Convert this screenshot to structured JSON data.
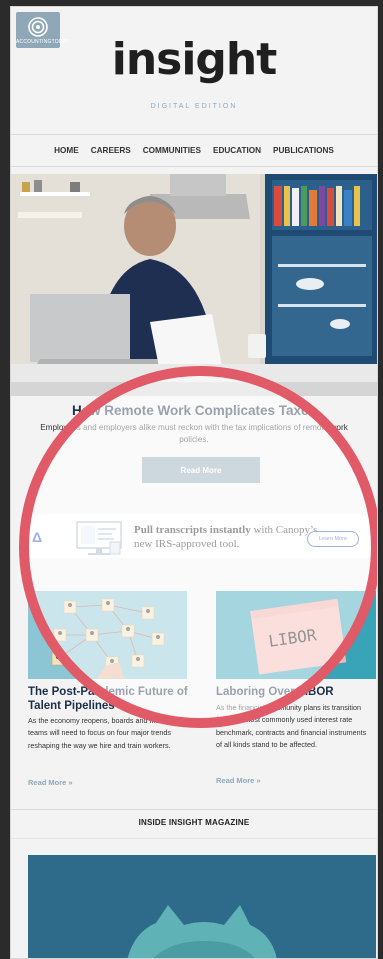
{
  "badge": {
    "text": "ACCOUNTINGTODAY"
  },
  "logo": {
    "title": "insight",
    "subtitle": "DIGITAL EDITION"
  },
  "nav": {
    "items": [
      "HOME",
      "CAREERS",
      "COMMUNITIES",
      "EDUCATION",
      "PUBLICATIONS"
    ]
  },
  "feature": {
    "title": "How Remote Work Complicates Taxes",
    "summary": "Employees and employers alike must reckon with the tax implications of remote work policies.",
    "button": "Read More"
  },
  "ad": {
    "logo": "Δ",
    "headline_bold": "Pull transcripts instantly",
    "headline_rest": " with Canopy’s new IRS-approved tool.",
    "button": "Learn More"
  },
  "cards": [
    {
      "title": "The Post-Pandemic Future of Talent Pipelines",
      "body": "As the economy reopens, boards and management teams will need to focus on four major trends reshaping the way we hire and train workers.",
      "link": "Read More »"
    },
    {
      "title": "Laboring Over LIBOR",
      "body": "As the financial community plans its transition from the most commonly used interest rate benchmark, contracts and financial instruments of all kinds stand to be affected.",
      "link": "Read More »",
      "image_text": "LIBOR"
    }
  ],
  "section": {
    "title": "INSIDE INSIGHT MAGAZINE"
  },
  "colors": {
    "accent": "#8fa8b7",
    "headline": "#1c2f4a",
    "circle": "#e15a67",
    "ad_blue": "#2453c9"
  }
}
